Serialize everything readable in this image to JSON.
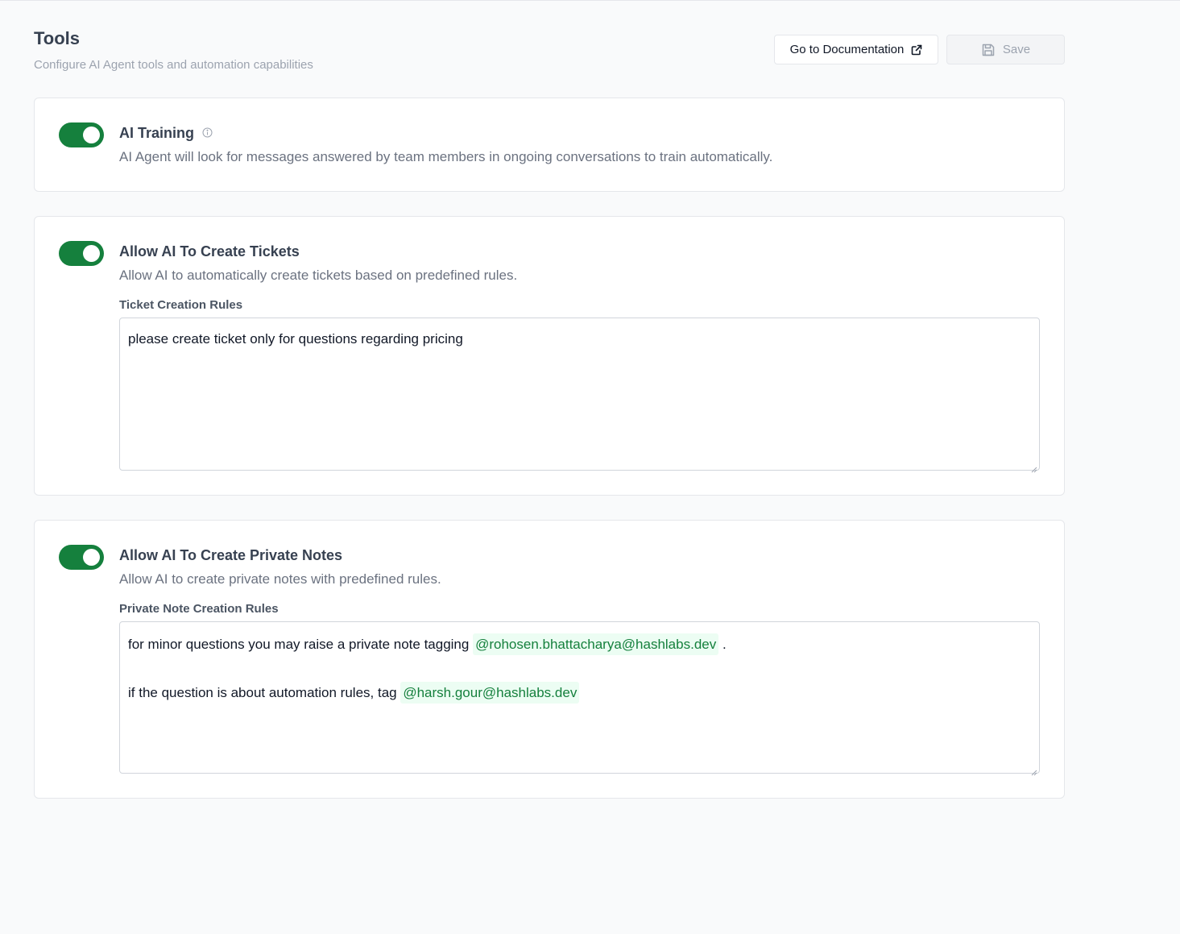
{
  "header": {
    "title": "Tools",
    "subtitle": "Configure AI Agent tools and automation capabilities",
    "doc_button": "Go to Documentation",
    "save_button": "Save"
  },
  "tools": {
    "training": {
      "title": "AI Training",
      "description": "AI Agent will look for messages answered by team members in ongoing conversations to train automatically.",
      "enabled": true
    },
    "tickets": {
      "title": "Allow AI To Create Tickets",
      "description": "Allow AI to automatically create tickets based on predefined rules.",
      "field_label": "Ticket Creation Rules",
      "value": "please create ticket only for questions regarding pricing",
      "enabled": true
    },
    "notes": {
      "title": "Allow AI To Create Private Notes",
      "description": "Allow AI to create private notes with predefined rules.",
      "field_label": "Private Note Creation Rules",
      "line1_text": "for minor questions you may raise a private note tagging",
      "line1_mention": "@rohosen.bhattacharya@hashlabs.dev",
      "line1_end": ".",
      "line2_text": "if the question is about automation rules, tag",
      "line2_mention": "@harsh.gour@hashlabs.dev",
      "enabled": true
    }
  },
  "colors": {
    "toggle_on": "#15803d",
    "mention_bg": "#ecfdf3",
    "mention_text": "#15803d"
  },
  "icons": [
    "external-link-icon",
    "save-icon",
    "info-icon",
    "resize-handle-icon"
  ]
}
